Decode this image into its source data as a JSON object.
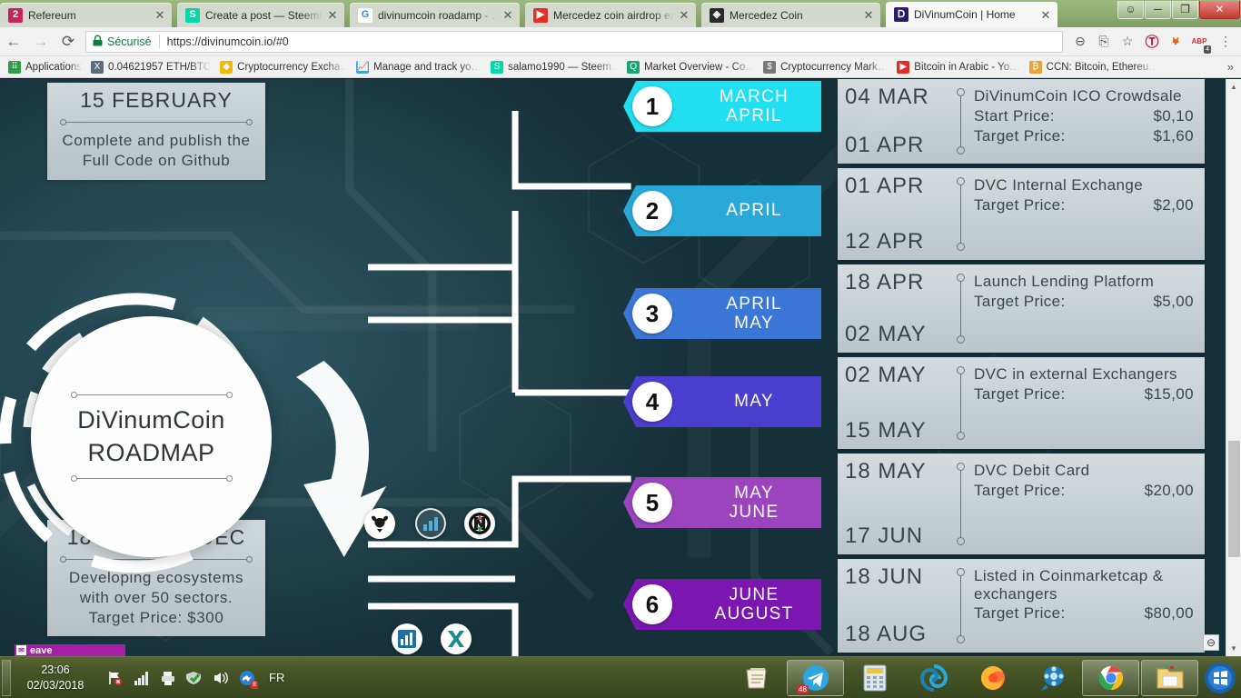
{
  "browser": {
    "tabs": [
      {
        "label": "Refereum",
        "icon": "refereum-icon",
        "color": "#c7235d",
        "glyph": "2",
        "active": false
      },
      {
        "label": "Create a post — Steemit",
        "icon": "steemit-icon",
        "color": "#06d6a9",
        "glyph": "S",
        "active": false
      },
      {
        "label": "divinumcoin roadamp - …",
        "icon": "google-icon",
        "color": "#ffffff",
        "glyph": "G",
        "active": false
      },
      {
        "label": "Mercedez coin airdrop ea…",
        "icon": "youtube-icon",
        "color": "#e52d27",
        "glyph": "▶",
        "active": false
      },
      {
        "label": "Mercedez Coin",
        "icon": "mercedez-icon",
        "color": "#2a2a2a",
        "glyph": "◈",
        "active": false
      },
      {
        "label": "DiVinumCoin | Home",
        "icon": "divinumcoin-icon",
        "color": "#2b1a6b",
        "glyph": "Ⅾ",
        "active": true
      }
    ],
    "tab_close_label": "✕",
    "window_controls": {
      "minimize": "─",
      "maximize": "❐",
      "close": "✕",
      "user": "☺"
    },
    "nav": {
      "back": "←",
      "forward": "→",
      "reload": "⟳",
      "security_label": "Sécurisé",
      "lock_icon": "🔒",
      "url": "https://divinumcoin.io/#0",
      "zoom_out_icon": "⊖",
      "translate_icon": "⎘",
      "bookmark_star_icon": "☆",
      "menu_icon": "⋮"
    },
    "extensions": [
      {
        "name": "trustpilot-extension",
        "glyph": "Ⓣ",
        "color": "#c8102e"
      },
      {
        "name": "metamask-extension",
        "glyph": "🦊",
        "color": "#e2761b"
      },
      {
        "name": "adblock-plus-extension",
        "glyph": "ABP",
        "color": "#d32f2f",
        "badge": "4"
      }
    ],
    "bookmarks": [
      {
        "label": "Applications",
        "icon": "apps-grid-icon",
        "color": "#2e9e4a",
        "glyph": "⠿"
      },
      {
        "label": "0.04621957 ETH/BTC",
        "icon": "poloniex-icon",
        "color": "#5b6b7c",
        "glyph": "X"
      },
      {
        "label": "Cryptocurrency Excha…",
        "icon": "binance-icon",
        "color": "#f0b90b",
        "glyph": "◆"
      },
      {
        "label": "Manage and track yo…",
        "icon": "chart-icon",
        "color": "#3ba3e0",
        "glyph": "📈"
      },
      {
        "label": "salamo1990 — Steem…",
        "icon": "steemit-icon",
        "color": "#06d6a9",
        "glyph": "S"
      },
      {
        "label": "Market Overview - Co…",
        "icon": "coinmarket-icon",
        "color": "#17a673",
        "glyph": "Q"
      },
      {
        "label": "Cryptocurrency Mark…",
        "icon": "dollar-icon",
        "color": "#777777",
        "glyph": "$"
      },
      {
        "label": "Bitcoin in Arabic - Yo…",
        "icon": "youtube-icon",
        "color": "#e52d27",
        "glyph": "▶"
      },
      {
        "label": "CCN: Bitcoin, Ethereu…",
        "icon": "ccn-icon",
        "color": "#e8a33d",
        "glyph": "₿"
      }
    ],
    "bookmarks_overflow": "»"
  },
  "page": {
    "logo": {
      "line1": "DiVinumCoin",
      "line2": "ROADMAP"
    },
    "left_cards": [
      {
        "name": "milestone-card-february",
        "head": "15 FEBRUARY",
        "body": "Complete and publish the Full Code on Github"
      },
      {
        "name": "milestone-card-aug-dec",
        "head": "18 AUG - 31 DEC",
        "body": "Developing ecosystems with over 50 sectors. Target Price: $300"
      }
    ],
    "phases": [
      {
        "number": "1",
        "label": "MARCH\nAPRIL",
        "color": "#21dff0"
      },
      {
        "number": "2",
        "label": "APRIL",
        "color": "#29a9d8"
      },
      {
        "number": "3",
        "label": "APRIL\nMAY",
        "color": "#3a77d6"
      },
      {
        "number": "4",
        "label": "MAY",
        "color": "#4a3ecf"
      },
      {
        "number": "5",
        "label": "MAY\nJUNE",
        "color": "#9b44be"
      },
      {
        "number": "6",
        "label": "JUNE\nAUGUST",
        "color": "#7b17b0"
      }
    ],
    "details": [
      {
        "date_start": "04 MAR",
        "date_end": "01 APR",
        "title": "DiVinumCoin ICO Crowdsale",
        "rows": [
          {
            "label": "Start Price:",
            "value": "$0,10"
          },
          {
            "label": "Target Price:",
            "value": "$1,60"
          }
        ]
      },
      {
        "date_start": "01 APR",
        "date_end": "12 APR",
        "title": "DVC Internal Exchange",
        "rows": [
          {
            "label": "Target Price:",
            "value": "$2,00"
          }
        ]
      },
      {
        "date_start": "18 APR",
        "date_end": "02 MAY",
        "title": "Launch Lending Platform",
        "rows": [
          {
            "label": "Target Price:",
            "value": "$5,00"
          }
        ]
      },
      {
        "date_start": "02 MAY",
        "date_end": "15 MAY",
        "title": "DVC in external Exchangers",
        "rows": [
          {
            "label": "Target Price:",
            "value": "$15,00"
          }
        ]
      },
      {
        "date_start": "18 MAY",
        "date_end": "17 JUN",
        "title": "DVC Debit Card",
        "rows": [
          {
            "label": "Target Price:",
            "value": "$20,00"
          }
        ]
      },
      {
        "date_start": "18 JUN",
        "date_end": "18 AUG",
        "title": "Listed in Coinmarketcap & exchangers",
        "rows": [
          {
            "label": "Target Price:",
            "value": "$80,00"
          }
        ]
      }
    ],
    "badges": [
      {
        "name": "bull-head-icon"
      },
      {
        "name": "bar-chart-icon"
      },
      {
        "name": "n-compass-icon"
      },
      {
        "name": "blue-bar-chart-icon"
      },
      {
        "name": "x-exchange-icon"
      }
    ],
    "scrollbar": {
      "up": "▲",
      "down": "▼"
    },
    "zoom_indicator": "⊖",
    "background_window_title": "eave"
  },
  "taskbar": {
    "time": "23:06",
    "date": "02/03/2018",
    "language": "FR",
    "tray": [
      {
        "name": "network-disconnected-icon"
      },
      {
        "name": "signal-bars-icon"
      },
      {
        "name": "printer-icon"
      },
      {
        "name": "security-shield-icon"
      },
      {
        "name": "volume-icon"
      },
      {
        "name": "messenger-icon",
        "badge": "8"
      }
    ],
    "apps": [
      {
        "name": "notepad-taskbar-icon",
        "open": false
      },
      {
        "name": "telegram-taskbar-icon",
        "open": true,
        "badge": "48"
      },
      {
        "name": "calculator-taskbar-icon",
        "open": false
      },
      {
        "name": "spiral-app-taskbar-icon",
        "open": false
      },
      {
        "name": "firefox-taskbar-icon",
        "open": false
      },
      {
        "name": "media-player-taskbar-icon",
        "open": false
      },
      {
        "name": "chrome-taskbar-icon",
        "open": true
      },
      {
        "name": "file-explorer-taskbar-icon",
        "open": true
      },
      {
        "name": "start-orb",
        "open": false
      }
    ]
  }
}
